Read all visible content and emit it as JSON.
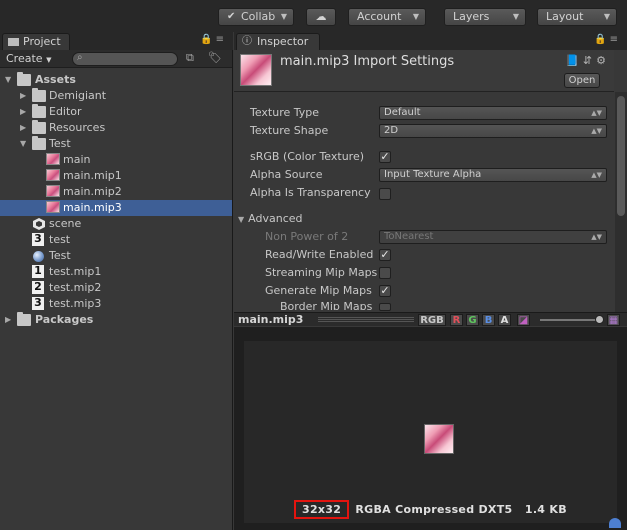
{
  "toolbar": {
    "collab_label": "Collab",
    "account_label": "Account",
    "layers_label": "Layers",
    "layout_label": "Layout"
  },
  "project": {
    "tab_label": "Project",
    "create_label": "Create",
    "search_value": "",
    "tree": [
      {
        "label": "Assets",
        "bold": true
      },
      {
        "label": "Demigiant"
      },
      {
        "label": "Editor"
      },
      {
        "label": "Resources"
      },
      {
        "label": "Test"
      },
      {
        "label": "main"
      },
      {
        "label": "main.mip1"
      },
      {
        "label": "main.mip2"
      },
      {
        "label": "main.mip3",
        "selected": true
      },
      {
        "label": "scene"
      },
      {
        "label": "test",
        "number": "3"
      },
      {
        "label": "Test"
      },
      {
        "label": "test.mip1",
        "number": "1"
      },
      {
        "label": "test.mip2",
        "number": "2"
      },
      {
        "label": "test.mip3",
        "number": "3"
      },
      {
        "label": "Packages",
        "bold": true
      }
    ]
  },
  "inspector": {
    "tab_label": "Inspector",
    "title": "main.mip3 Import Settings",
    "open_label": "Open",
    "fields": {
      "texture_type_label": "Texture Type",
      "texture_type_value": "Default",
      "texture_shape_label": "Texture Shape",
      "texture_shape_value": "2D",
      "srgb_label": "sRGB (Color Texture)",
      "alpha_source_label": "Alpha Source",
      "alpha_source_value": "Input Texture Alpha",
      "alpha_transparency_label": "Alpha Is Transparency",
      "advanced_label": "Advanced",
      "npot_label": "Non Power of 2",
      "npot_value": "ToNearest",
      "readwrite_label": "Read/Write Enabled",
      "streaming_label": "Streaming Mip Maps",
      "genmip_label": "Generate Mip Maps",
      "bordermip_label": "Border Mip Maps"
    }
  },
  "preview": {
    "title": "main.mip3",
    "channels": [
      "RGB",
      "R",
      "G",
      "B",
      "A"
    ],
    "size": "32x32",
    "format": "RGBA Compressed DXT5",
    "filesize": "1.4 KB"
  },
  "colors": {
    "selection": "#3e5f96",
    "highlight_box": "#e3140f",
    "channel_r": "#e0505a",
    "channel_g": "#5fc55f",
    "channel_b": "#5a8fe6"
  }
}
